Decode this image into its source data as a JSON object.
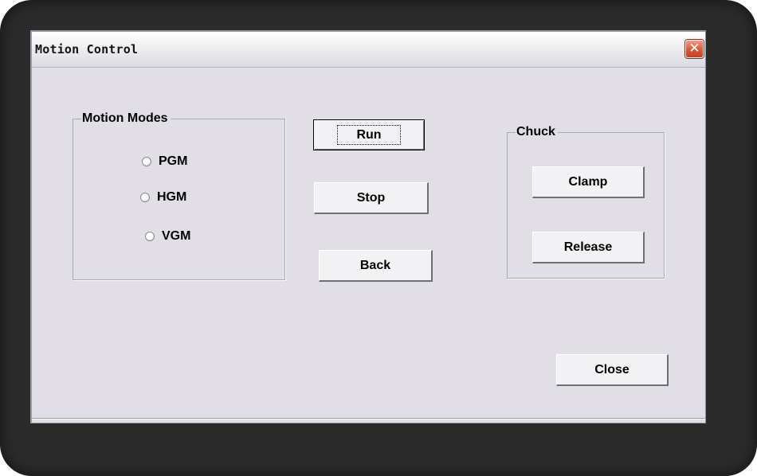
{
  "window": {
    "title": "Motion Control",
    "close_glyph": "✕"
  },
  "motion_modes": {
    "label": "Motion Modes",
    "options": [
      "PGM",
      "HGM",
      "VGM"
    ],
    "selected": null
  },
  "actions": {
    "run_label": "Run",
    "stop_label": "Stop",
    "back_label": "Back"
  },
  "chuck": {
    "label": "Chuck",
    "clamp_label": "Clamp",
    "release_label": "Release"
  },
  "footer": {
    "close_label": "Close"
  },
  "colors": {
    "dialog_background": "#e1dfe5",
    "close_button": "#d9573a",
    "frame": "#2b2b2b"
  },
  "icons": {
    "close": "close-icon",
    "radio": "radio-button-icon"
  }
}
